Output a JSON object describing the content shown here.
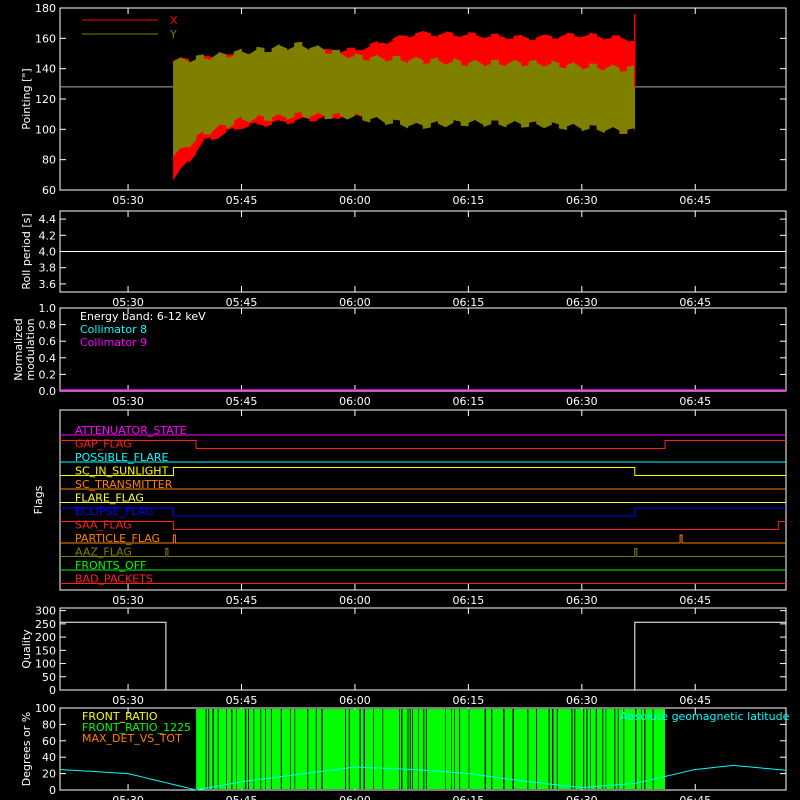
{
  "chart_data": [
    {
      "type": "line",
      "ylabel": "Pointing [\"]",
      "xlim": [
        "05:21",
        "06:57"
      ],
      "ylim": [
        60,
        180
      ],
      "yticks": [
        60,
        80,
        100,
        120,
        140,
        160,
        180
      ],
      "xtick_labels": [
        "05:30",
        "05:45",
        "06:00",
        "06:15",
        "06:30",
        "06:45"
      ],
      "reference_line": 128,
      "data_span": [
        "05:36",
        "06:37"
      ],
      "series": [
        {
          "name": "X",
          "color": "#ff0000",
          "upper": [
            [
              "05:36",
              147
            ],
            [
              "05:45",
              150
            ],
            [
              "06:00",
              154
            ],
            [
              "06:08",
              165
            ],
            [
              "06:15",
              164
            ],
            [
              "06:23",
              162
            ],
            [
              "06:30",
              164
            ],
            [
              "06:37",
              161
            ]
          ],
          "lower": [
            [
              "05:36",
              65
            ],
            [
              "05:40",
              90
            ],
            [
              "05:45",
              100
            ],
            [
              "05:52",
              104
            ],
            [
              "06:00",
              108
            ],
            [
              "06:08",
              108
            ],
            [
              "06:15",
              106
            ],
            [
              "06:23",
              105
            ],
            [
              "06:30",
              104
            ],
            [
              "06:37",
              103
            ]
          ]
        },
        {
          "name": "Y",
          "color": "#808000",
          "upper": [
            [
              "05:36",
              147
            ],
            [
              "05:45",
              153
            ],
            [
              "05:53",
              158
            ],
            [
              "06:00",
              150
            ],
            [
              "06:08",
              148
            ],
            [
              "06:15",
              146
            ],
            [
              "06:23",
              146
            ],
            [
              "06:30",
              144
            ],
            [
              "06:37",
              142
            ]
          ],
          "lower": [
            [
              "05:36",
              80
            ],
            [
              "05:40",
              95
            ],
            [
              "05:45",
              104
            ],
            [
              "05:53",
              107
            ],
            [
              "06:00",
              106
            ],
            [
              "06:08",
              100
            ],
            [
              "06:15",
              102
            ],
            [
              "06:23",
              101
            ],
            [
              "06:30",
              99
            ],
            [
              "06:37",
              96
            ]
          ]
        }
      ]
    },
    {
      "type": "line",
      "ylabel": "Roll period [s]",
      "ylim": [
        3.5,
        4.5
      ],
      "yticks": [
        3.6,
        3.8,
        4.0,
        4.2,
        4.4
      ],
      "xtick_labels": [
        "05:30",
        "05:45",
        "06:00",
        "06:15",
        "06:30",
        "06:45"
      ],
      "series": [
        {
          "color": "#ffffff",
          "values": [
            [
              "05:21",
              4.0
            ],
            [
              "06:57",
              4.0
            ]
          ]
        }
      ]
    },
    {
      "type": "line",
      "ylabel_lines": [
        "Normalized",
        "modulation"
      ],
      "ylim": [
        0,
        1.0
      ],
      "yticks": [
        0.0,
        0.2,
        0.4,
        0.6,
        0.8,
        1.0
      ],
      "xtick_labels": [
        "05:30",
        "05:45",
        "06:00",
        "06:15",
        "06:30",
        "06:45"
      ],
      "annotations": [
        "Energy band: 6-12 keV",
        "Collimator 8",
        "Collimator 9"
      ],
      "annotation_colors": [
        "#ffffff",
        "#00ffff",
        "#ff00ff"
      ],
      "series": [
        {
          "color": "#ff00ff",
          "values": [
            [
              "05:21",
              0.0
            ],
            [
              "06:57",
              0.0
            ]
          ]
        }
      ]
    },
    {
      "type": "line",
      "ylabel": "Flags",
      "xtick_labels": [
        "05:30",
        "05:45",
        "06:00",
        "06:15",
        "06:30",
        "06:45"
      ],
      "flags": [
        {
          "name": "ATTENUATOR_STATE",
          "color": "#ff00ff",
          "transitions": []
        },
        {
          "name": "GAP_FLAG",
          "color": "#ff2020",
          "initial": 1,
          "transitions": [
            [
              "05:39",
              0
            ],
            [
              "06:41",
              1
            ]
          ]
        },
        {
          "name": "POSSIBLE_FLARE",
          "color": "#00ffff",
          "transitions": []
        },
        {
          "name": "SC_IN_SUNLIGHT",
          "color": "#ffff00",
          "initial": 0,
          "transitions": [
            [
              "05:36",
              1
            ],
            [
              "06:37",
              0
            ]
          ]
        },
        {
          "name": "SC_TRANSMITTER",
          "color": "#ff8000",
          "transitions": []
        },
        {
          "name": "FLARE_FLAG",
          "color": "#ffff40",
          "transitions": []
        },
        {
          "name": "ECLIPSE_FLAG",
          "color": "#0000ff",
          "initial": 1,
          "transitions": [
            [
              "05:36",
              0
            ],
            [
              "06:37",
              1
            ]
          ]
        },
        {
          "name": "SAA_FLAG",
          "color": "#ff2020",
          "initial": 1,
          "transitions": [
            [
              "05:36",
              0
            ],
            [
              "06:56",
              1
            ]
          ]
        },
        {
          "name": "PARTICLE_FLAG",
          "color": "#ff8000",
          "spikes": [
            "05:36",
            "06:43"
          ]
        },
        {
          "name": "AAZ_FLAG",
          "color": "#808000",
          "spikes": [
            "05:35",
            "06:37"
          ]
        },
        {
          "name": "FRONTS_OFF",
          "color": "#00ff00",
          "transitions": []
        },
        {
          "name": "BAD_PACKETS",
          "color": "#ff2020",
          "transitions": []
        }
      ]
    },
    {
      "type": "line",
      "ylabel": "Quality",
      "ylim": [
        0,
        310
      ],
      "yticks": [
        0,
        50,
        100,
        150,
        200,
        250,
        300
      ],
      "xtick_labels": [
        "05:30",
        "05:45",
        "06:00",
        "06:15",
        "06:30",
        "06:45"
      ],
      "series": [
        {
          "color": "#ffffff",
          "values": [
            [
              "05:21",
              256
            ],
            [
              "05:35",
              256
            ],
            [
              "05:35",
              0
            ],
            [
              "06:37",
              0
            ],
            [
              "06:37",
              256
            ],
            [
              "06:57",
              256
            ]
          ]
        }
      ]
    },
    {
      "type": "area",
      "ylabel": "Degrees or %",
      "ylim": [
        0,
        100
      ],
      "yticks": [
        0,
        20,
        40,
        60,
        80,
        100
      ],
      "xtick_labels": [
        "05:30",
        "05:45",
        "06:00",
        "06:15",
        "06:30",
        "06:45"
      ],
      "legend": [
        "FRONT_RATIO",
        "FRONT_RATIO_1225",
        "MAX_DET_VS_TOT"
      ],
      "legend_colors": [
        "#ffff00",
        "#00ff00",
        "#ff8000"
      ],
      "annotation": "Absolute geomagnetic latitude",
      "annotation_color": "#00ffff",
      "green_span": [
        "05:39",
        "06:41"
      ],
      "latitude": [
        [
          "05:21",
          25
        ],
        [
          "05:30",
          20
        ],
        [
          "05:39",
          0
        ],
        [
          "05:45",
          10
        ],
        [
          "06:00",
          28
        ],
        [
          "06:08",
          25
        ],
        [
          "06:15",
          20
        ],
        [
          "06:23",
          10
        ],
        [
          "06:30",
          3
        ],
        [
          "06:37",
          8
        ],
        [
          "06:45",
          25
        ],
        [
          "06:50",
          30
        ],
        [
          "06:57",
          24
        ]
      ]
    }
  ]
}
